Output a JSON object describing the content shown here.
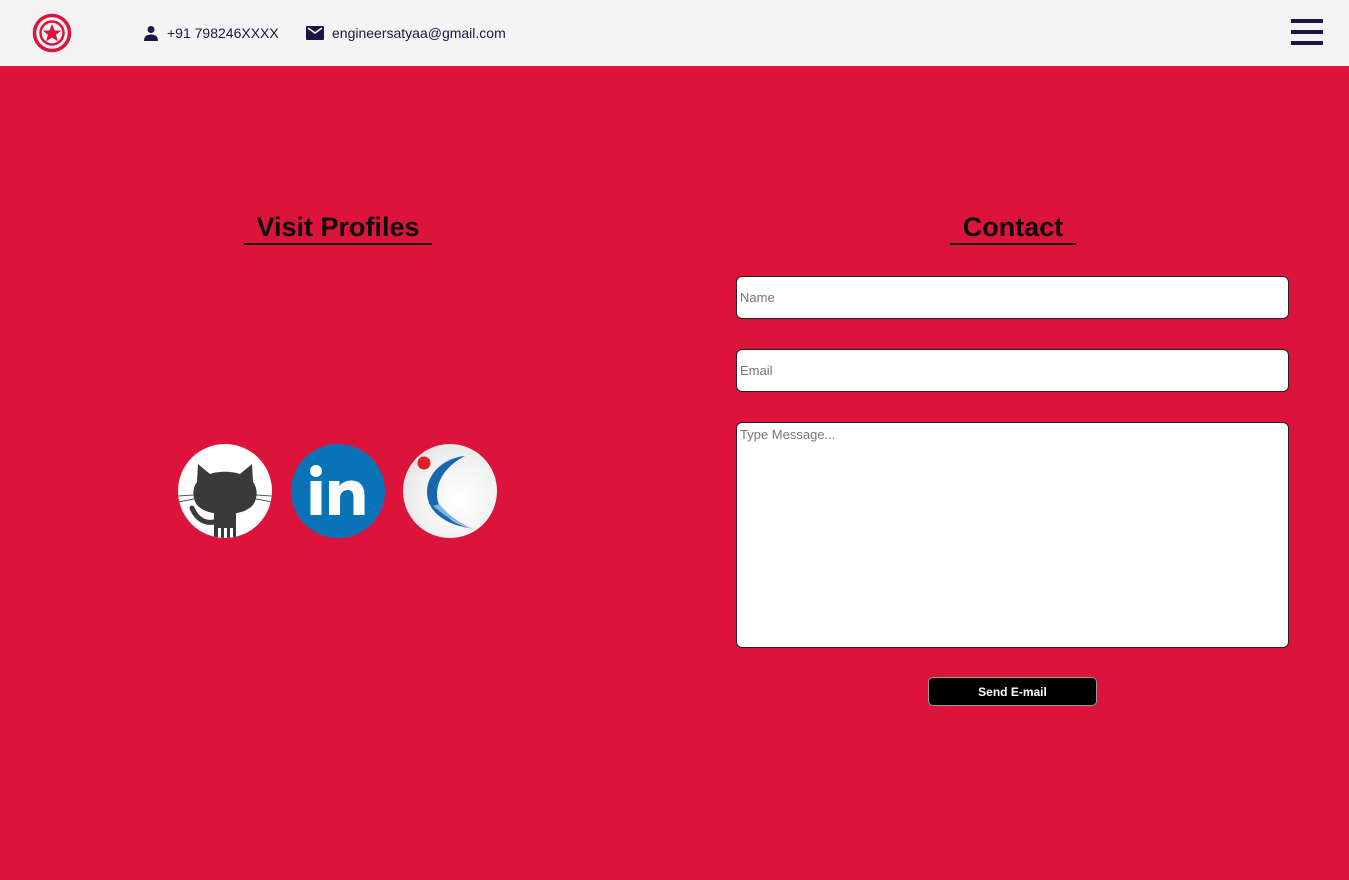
{
  "header": {
    "phone": "+91 798246XXXX",
    "email": "engineersatyaa@gmail.com",
    "logo_icon": "star-circle-icon",
    "menu_icon": "hamburger-menu-icon"
  },
  "profiles": {
    "title": "Visit Profiles",
    "items": [
      {
        "name": "GitHub",
        "icon": "github-icon"
      },
      {
        "name": "LinkedIn",
        "icon": "linkedin-icon"
      },
      {
        "name": "Naukri",
        "icon": "naukri-icon"
      }
    ]
  },
  "contact": {
    "title": "Contact",
    "name_placeholder": "Name",
    "email_placeholder": "Email",
    "message_placeholder": "Type Message...",
    "send_label": "Send E-mail"
  },
  "colors": {
    "background": "#dc143c",
    "header_bg": "#f4f4f4",
    "header_text": "#1d1645",
    "button_bg": "#000000",
    "linkedin_blue": "#0a73b7"
  }
}
